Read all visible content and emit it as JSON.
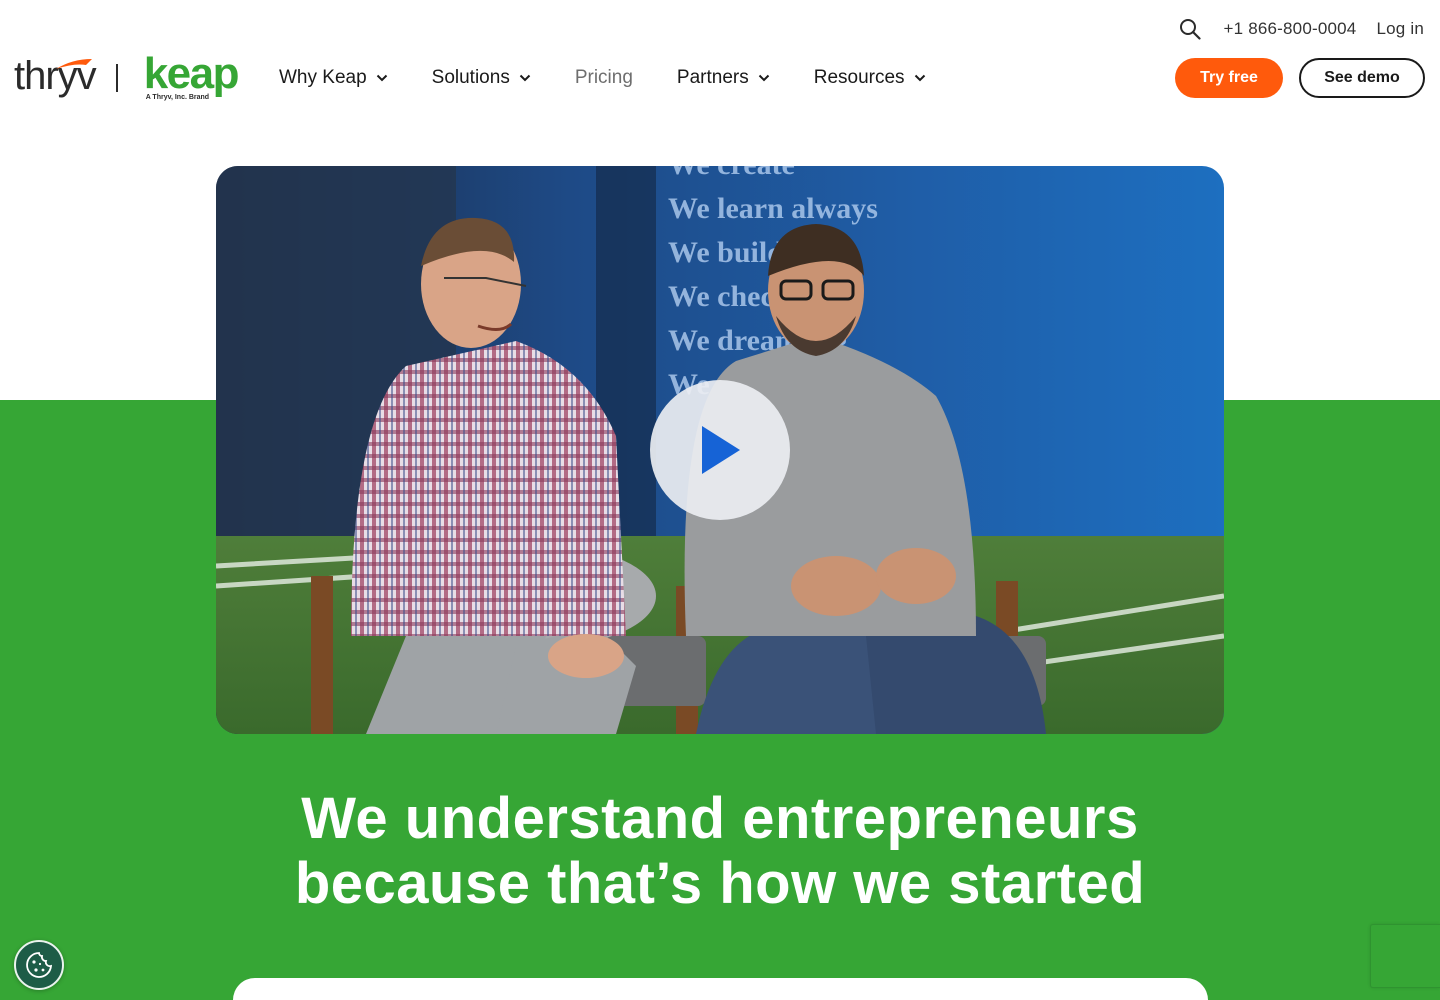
{
  "utility": {
    "phone": "+1 866-800-0004",
    "login": "Log in",
    "search_icon": "search-icon"
  },
  "brand": {
    "thryv": "thryv",
    "keap": "keap",
    "keap_tagline": "A Thryv, Inc. Brand",
    "thryv_color": "#2b2b2b",
    "keap_color": "#36a635",
    "swoosh_color": "#ff5a0c"
  },
  "nav": {
    "items": [
      {
        "label": "Why Keap",
        "dropdown": true
      },
      {
        "label": "Solutions",
        "dropdown": true
      },
      {
        "label": "Pricing",
        "dropdown": false
      },
      {
        "label": "Partners",
        "dropdown": true
      },
      {
        "label": "Resources",
        "dropdown": true
      }
    ]
  },
  "cta": {
    "try_free": "Try free",
    "see_demo": "See demo",
    "try_color": "#ff5a0c"
  },
  "hero": {
    "wall_lines": [
      "We create",
      "We learn always",
      "We build trust",
      "We check our...",
      "We dream big",
      "We..."
    ],
    "play_icon": "play-icon",
    "headline_line1": "We understand entrepreneurs",
    "headline_line2": "because that’s how we started",
    "background_color": "#36a635"
  },
  "misc": {
    "cookie_icon": "cookie-icon"
  }
}
